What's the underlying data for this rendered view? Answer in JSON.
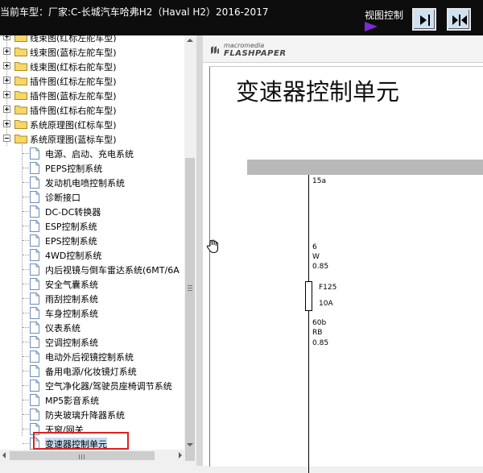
{
  "header": {
    "car_title": "当前车型：厂家:C-长城汽车哈弗H2（Haval H2）2016-2017",
    "view_control_label": "视图控制",
    "expand_button_icon": "expand-arrow-icon",
    "collapse_button_icon": "collapse-arrows-icon"
  },
  "tree": {
    "folders": [
      {
        "label": "线束图(红标左舵车型)",
        "state": "collapsed"
      },
      {
        "label": "线束图(蓝标左舵车型)",
        "state": "collapsed"
      },
      {
        "label": "线束图(红标右舵车型)",
        "state": "collapsed"
      },
      {
        "label": "插件图(红标左舵车型)",
        "state": "collapsed"
      },
      {
        "label": "插件图(蓝标左舵车型)",
        "state": "collapsed"
      },
      {
        "label": "插件图(红标右舵车型)",
        "state": "collapsed"
      },
      {
        "label": "系统原理图(红标车型)",
        "state": "collapsed"
      },
      {
        "label": "系统原理图(蓝标车型)",
        "state": "expanded"
      }
    ],
    "documents": [
      "电源、启动、充电系统",
      "PEPS控制系统",
      "发动机电喷控制系统",
      "诊断接口",
      "DC-DC转换器",
      "ESP控制系统",
      "EPS控制系统",
      "4WD控制系统",
      "内后视镜与倒车雷达系统(6MT/6A",
      "安全气囊系统",
      "雨刮控制系统",
      "车身控制系统",
      "仪表系统",
      "空调控制系统",
      "电动外后视镜控制系统",
      "备用电源/化妆镜灯系统",
      "空气净化器/驾驶员座椅调节系统",
      "MP5影音系统",
      "防夹玻璃升降器系统",
      "天窗/网关",
      "变速器控制单元"
    ],
    "selected_index": 20
  },
  "viewer": {
    "brand_small": "macromedia",
    "brand_large": "FLASHPAPER",
    "doc_title": "变速器控制单元",
    "wire": {
      "top_label": "15a",
      "pin1": "6",
      "color1": "W",
      "size1": "0.85",
      "fuse_name": "F125",
      "fuse_rating": "10A",
      "pin2": "60b",
      "color2": "RB",
      "size2": "0.85"
    }
  },
  "colors": {
    "header_bg": "#0d0d0d",
    "selection_outline": "#e02020",
    "play_icon": "#7b2bd6",
    "band_gray": "#b9b9b9"
  }
}
